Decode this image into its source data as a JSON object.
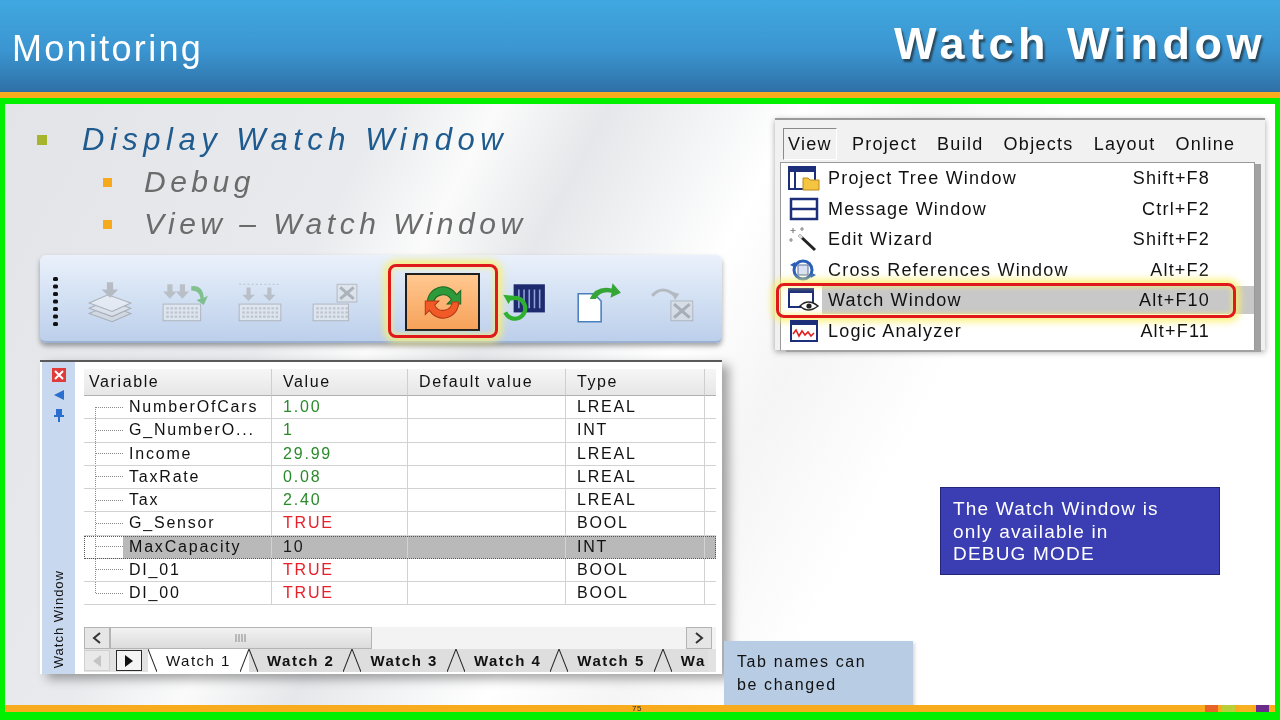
{
  "header": {
    "title": "Monitoring",
    "subtitle": "Watch Window"
  },
  "bullets": [
    {
      "text": "Display Watch Window",
      "children": [
        {
          "text": "Debug"
        },
        {
          "text": "View – Watch Window"
        }
      ]
    }
  ],
  "toolbar": {
    "buttons": [
      {
        "disabled": true,
        "selected": false,
        "highlighted": false
      },
      {
        "disabled": true,
        "selected": false,
        "highlighted": false
      },
      {
        "disabled": true,
        "selected": false,
        "highlighted": false
      },
      {
        "disabled": true,
        "selected": false,
        "highlighted": false
      },
      {
        "disabled": false,
        "selected": true,
        "highlighted": true
      },
      {
        "disabled": false,
        "selected": false,
        "highlighted": false
      },
      {
        "disabled": false,
        "selected": false,
        "highlighted": false
      },
      {
        "disabled": true,
        "selected": false,
        "highlighted": false
      }
    ]
  },
  "menu": {
    "menubar": [
      {
        "label": "View",
        "selected": true
      },
      {
        "label": "Project",
        "selected": false
      },
      {
        "label": "Build",
        "selected": false
      },
      {
        "label": "Objects",
        "selected": false
      },
      {
        "label": "Layout",
        "selected": false
      },
      {
        "label": "Online",
        "selected": false
      }
    ],
    "items": [
      {
        "label": "Project Tree Window",
        "shortcut": "Shift+F8",
        "selected": false,
        "highlighted": false
      },
      {
        "label": "Message Window",
        "shortcut": "Ctrl+F2",
        "selected": false,
        "highlighted": false
      },
      {
        "label": "Edit Wizard",
        "shortcut": "Shift+F2",
        "selected": false,
        "highlighted": false
      },
      {
        "label": "Cross References Window",
        "shortcut": "Alt+F2",
        "selected": false,
        "highlighted": false
      },
      {
        "label": "Watch Window",
        "shortcut": "Alt+F10",
        "selected": true,
        "highlighted": true
      },
      {
        "label": "Logic Analyzer",
        "shortcut": "Alt+F11",
        "selected": false,
        "highlighted": false
      }
    ]
  },
  "watch_window": {
    "side_title": "Watch Window",
    "columns": [
      "Variable",
      "Value",
      "Default value",
      "Type"
    ],
    "rows": [
      {
        "variable": "NumberOfCars",
        "value": "1.00",
        "type": "LREAL",
        "color": "#2a8a2a",
        "selected": false
      },
      {
        "variable": "G_NumberO...",
        "value": "1",
        "type": "INT",
        "color": "#2a8a2a",
        "selected": false
      },
      {
        "variable": "Income",
        "value": "29.99",
        "type": "LREAL",
        "color": "#2a8a2a",
        "selected": false
      },
      {
        "variable": "TaxRate",
        "value": "0.08",
        "type": "LREAL",
        "color": "#2a8a2a",
        "selected": false
      },
      {
        "variable": "Tax",
        "value": "2.40",
        "type": "LREAL",
        "color": "#2a8a2a",
        "selected": false
      },
      {
        "variable": "G_Sensor",
        "value": "TRUE",
        "type": "BOOL",
        "color": "#e8202a",
        "selected": false
      },
      {
        "variable": "MaxCapacity",
        "value": "10",
        "type": "INT",
        "color": "#1a1a1a",
        "selected": true
      },
      {
        "variable": "DI_01",
        "value": "TRUE",
        "type": "BOOL",
        "color": "#e8202a",
        "selected": false
      },
      {
        "variable": "DI_00",
        "value": "TRUE",
        "type": "BOOL",
        "color": "#e8202a",
        "selected": false
      }
    ],
    "tab_arrows": [
      {
        "disabled": true
      },
      {
        "disabled": false
      }
    ],
    "tabs": [
      {
        "label": "Watch 1",
        "selected": true
      },
      {
        "label": "Watch 2",
        "selected": false
      },
      {
        "label": "Watch 3",
        "selected": false
      },
      {
        "label": "Watch 4",
        "selected": false
      },
      {
        "label": "Watch 5",
        "selected": false
      },
      {
        "label": "Wa",
        "selected": false
      }
    ]
  },
  "debug_note": {
    "text": "The Watch Window is\nonly available in\nDEBUG MODE"
  },
  "tab_note": {
    "text": "Tab names can\nbe changed"
  },
  "footer": {
    "page_number": "75"
  }
}
